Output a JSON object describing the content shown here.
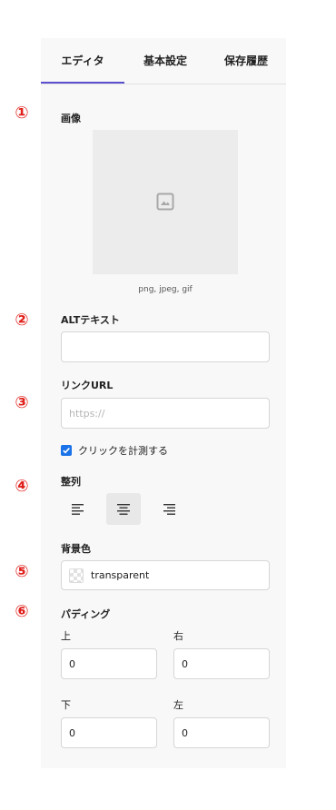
{
  "tabs": [
    {
      "label": "エディタ",
      "active": true
    },
    {
      "label": "基本設定",
      "active": false
    },
    {
      "label": "保存履歴",
      "active": false
    }
  ],
  "markers": [
    "①",
    "②",
    "③",
    "④",
    "⑤",
    "⑥"
  ],
  "image": {
    "label": "画像",
    "icon": "image-placeholder-icon",
    "caption": "png, jpeg, gif"
  },
  "alt": {
    "label": "ALTテキスト",
    "value": ""
  },
  "link": {
    "label": "リンクURL",
    "placeholder": "https://",
    "value": "",
    "track_label": "クリックを計測する",
    "track_checked": true
  },
  "align": {
    "label": "整列",
    "options": [
      "align-left-icon",
      "align-center-icon",
      "align-right-icon"
    ],
    "selected": "center"
  },
  "background": {
    "label": "背景色",
    "value": "transparent"
  },
  "padding": {
    "label": "パディング",
    "top": {
      "label": "上",
      "value": "0"
    },
    "right": {
      "label": "右",
      "value": "0"
    },
    "bottom": {
      "label": "下",
      "value": "0"
    },
    "left": {
      "label": "左",
      "value": "0"
    }
  },
  "colors": {
    "accent": "#5b4fcf",
    "marker": "#e0201b",
    "checkbox": "#1a73e8",
    "panel": "#f8f8f8"
  }
}
